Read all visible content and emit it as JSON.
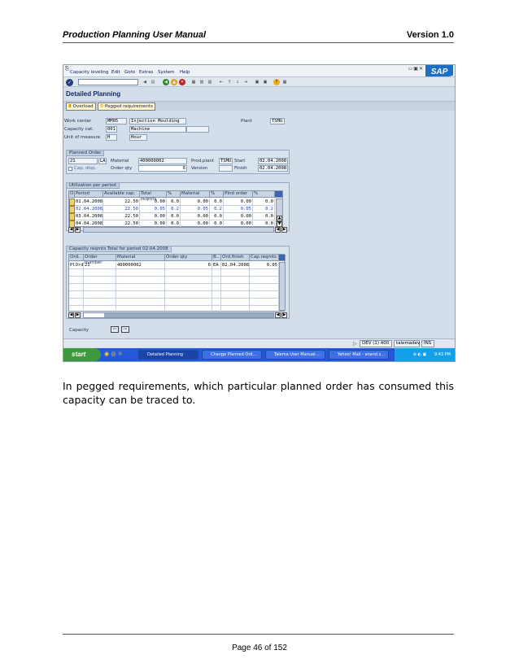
{
  "page": {
    "header_title": "Production Planning User Manual",
    "header_version": "Version 1.0",
    "paragraph": "In pegged requirements, which particular planned order has consumed this capacity can be traced to.",
    "footer": "Page 46 of 152"
  },
  "sap": {
    "menu": [
      "Capacity leveling",
      "Edit",
      "Goto",
      "Extras",
      "System",
      "Help"
    ],
    "logo": "SAP",
    "screen_title": "Detailed Planning",
    "app_buttons": {
      "overload": "Overload",
      "pegged": "Pegged requirements"
    },
    "header_fields": {
      "work_center_label": "Work center",
      "work_center": "MM05",
      "work_center_desc": "Injection Moulding",
      "plant_label": "Plant",
      "plant": "TSMU",
      "capacity_cat_label": "Capacity cat.",
      "capacity_cat": "001",
      "capacity_cat_desc": "Machine",
      "uom_label": "Unit of measure",
      "uom": "H",
      "uom_desc": "Hour"
    },
    "planned_order": {
      "title": "Planned Order",
      "order": "21",
      "type": "LA",
      "material_label": "Material",
      "material": "400000002",
      "prodplant_label": "Prod.plant",
      "prodplant": "TSMU",
      "start_label": "Start",
      "start": "02.04.2008",
      "cap_disp_label": "Cap. disp.",
      "order_qty_label": "Order qty",
      "order_qty": "6",
      "version_label": "Version",
      "finish_label": "Finish",
      "finish": "02.04.2008"
    },
    "utilization": {
      "title": "Utilization per period",
      "columns": [
        "O",
        "Period",
        "Available cap.",
        "Total reqmts",
        "%",
        "Material",
        "%",
        "Plnd order",
        "%"
      ],
      "rows": [
        [
          "01.04.2008",
          "22.50",
          "0.00",
          "0.0",
          "0.00",
          "0.0",
          "0.00",
          "0.0"
        ],
        [
          "02.04.2008",
          "22.50",
          "0.05",
          "0.2",
          "0.05",
          "0.2",
          "0.05",
          "0.2"
        ],
        [
          "03.04.2008",
          "22.50",
          "0.00",
          "0.0",
          "0.00",
          "0.0",
          "0.00",
          "0.0"
        ],
        [
          "04.04.2008",
          "22.50",
          "0.00",
          "0.0",
          "0.00",
          "0.0",
          "0.00",
          "0.0"
        ]
      ]
    },
    "capreq": {
      "title": "Capacity reqmts Total for period 02.04.2008",
      "columns": [
        "Ord..",
        "Order number",
        "Material",
        "Order qty",
        "B..",
        "Ord.finish",
        "Cap.reqmts"
      ],
      "row": [
        "PlOrd",
        "21",
        "400000002",
        "6",
        "EA",
        "02.04.2008",
        "0.05"
      ]
    },
    "capacity_label": "Capacity",
    "status": {
      "system": "DEV (1) 400",
      "host": "talemadev",
      "mode": "INS"
    },
    "taskbar": {
      "start": "start",
      "items": [
        "Detailed Planning",
        "Change Planned Ord...",
        "Talema User Manual-...",
        "Yahoo! Mail - anand.s..."
      ],
      "time": "9:43 PM"
    }
  }
}
